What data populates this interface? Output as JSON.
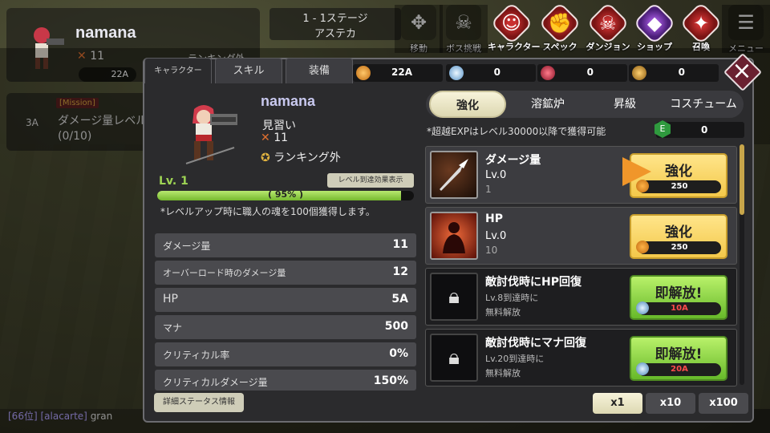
{
  "hud": {
    "player_name": "namana",
    "player_level": "11",
    "rank": "ランキング外",
    "gold": "22A",
    "mission_tag": "[Mission]",
    "mission_level": "3A",
    "mission_text": "ダメージ量レベル",
    "mission_progress": "(0/10)",
    "stage_line1": "1 - 1ステージ",
    "stage_line2": "アステカ",
    "chat_rank": "[66位]",
    "chat_name": "[alacarte]",
    "chat_msg": "gran"
  },
  "menu": [
    {
      "label": "移動",
      "icon": "move-icon"
    },
    {
      "label": "ボス挑戦",
      "icon": "boss-icon"
    },
    {
      "label": "キャラクター",
      "icon": "character-icon"
    },
    {
      "label": "スペック",
      "icon": "spec-icon"
    },
    {
      "label": "ダンジョン",
      "icon": "dungeon-icon"
    },
    {
      "label": "ショップ",
      "icon": "shop-icon"
    },
    {
      "label": "召喚",
      "icon": "summon-icon"
    },
    {
      "label": "メニュー",
      "icon": "menu-icon"
    }
  ],
  "tabs": [
    "キャラクター",
    "スキル",
    "装備"
  ],
  "resources": [
    {
      "value": "22A",
      "icon": "gold-coin-icon",
      "color": "#f0a030"
    },
    {
      "value": "0",
      "icon": "diamond-icon",
      "color": "#9ec6e6"
    },
    {
      "value": "0",
      "icon": "red-crystal-icon",
      "color": "#d0304a"
    },
    {
      "value": "0",
      "icon": "sun-medal-icon",
      "color": "#e0a030"
    }
  ],
  "character": {
    "name": "namana",
    "title": "見習い",
    "level_display": "11",
    "rank": "ランキング外",
    "lv_label": "Lv. 1",
    "lv_effect_button": "レベル到達効果表示",
    "xp_percent_text": "( 95% )",
    "xp_fraction": 0.95,
    "note": "*レベルアップ時に職人の魂を100個獲得します。",
    "detail_button": "詳細ステータス情報"
  },
  "stats": [
    {
      "label": "ダメージ量",
      "value": "11"
    },
    {
      "label": "オーバーロード時のダメージ量",
      "value": "12"
    },
    {
      "label": "HP",
      "value": "5A"
    },
    {
      "label": "マナ",
      "value": "500"
    },
    {
      "label": "クリティカル率",
      "value": "0%"
    },
    {
      "label": "クリティカルダメージ量",
      "value": "150%"
    }
  ],
  "subtabs": [
    "強化",
    "溶鉱炉",
    "昇級",
    "コスチューム"
  ],
  "exp_note": "*超越EXPはレベル30000以降で獲得可能",
  "exp_value": "0",
  "exp_icon_letter": "E",
  "skills": [
    {
      "name": "ダメージ量",
      "level": "Lv.0",
      "sub": "1",
      "button": "強化",
      "cost": "250",
      "locked": false
    },
    {
      "name": "HP",
      "level": "Lv.0",
      "sub": "10",
      "button": "強化",
      "cost": "250",
      "locked": false
    },
    {
      "name": "敵討伐時にHP回復",
      "level": "Lv.8到達時に",
      "sub": "無料解放",
      "button": "即解放!",
      "cost": "10A",
      "locked": true
    },
    {
      "name": "敵討伐時にマナ回復",
      "level": "Lv.20到達時に",
      "sub": "無料解放",
      "button": "即解放!",
      "cost": "20A",
      "locked": true
    }
  ],
  "multipliers": [
    "x1",
    "x10",
    "x100"
  ],
  "colors": {
    "accent_gold": "#f3c84a",
    "accent_green": "#67b92a",
    "xp_green": "#9ed454",
    "cost_red": "#ff4b4b"
  }
}
